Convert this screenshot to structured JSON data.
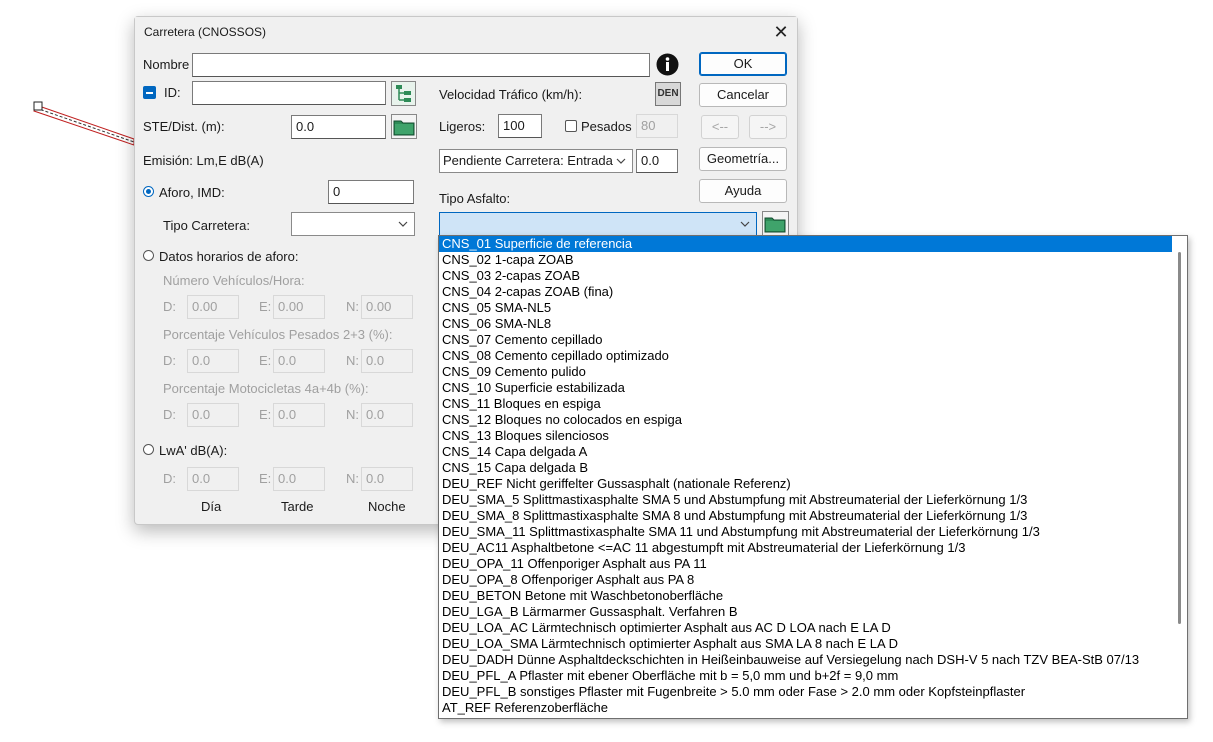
{
  "window": {
    "title": "Carretera (CNOSSOS)",
    "close_glyph": "✕"
  },
  "fields": {
    "nombre_label": "Nombre",
    "nombre_value": "",
    "id_label": "ID:",
    "id_value": "",
    "ste_label": "STE/Dist. (m):",
    "ste_value": "0.0",
    "emision_label": "Emisión: Lm,E dB(A)",
    "aforo_label": "Aforo, IMD:",
    "aforo_value": "0",
    "tipo_carretera_label": "Tipo Carretera:",
    "tipo_carretera_value": "",
    "datos_horarios_label": "Datos horarios de aforo:",
    "num_vehiculos_label": "Número Vehículos/Hora:",
    "pct_pesados_label": "Porcentaje Vehículos Pesados 2+3 (%):",
    "pct_moto_label": "Porcentaje Motocicletas  4a+4b (%):",
    "lwa_label": "LwA' dB(A):",
    "d_label": "D:",
    "e_label": "E:",
    "n_label": "N:",
    "row1": [
      "0.00",
      "0.00",
      "0.00"
    ],
    "row2": [
      "0.0",
      "0.0",
      "0.0"
    ],
    "row3": [
      "0.0",
      "0.0",
      "0.0"
    ],
    "row4": [
      "0.0",
      "0.0",
      "0.0"
    ],
    "dia_label": "Día",
    "tarde_label": "Tarde",
    "noche_label": "Noche"
  },
  "traffic": {
    "velocidad_label": "Velocidad Tráfico (km/h):",
    "den_label": "DEN",
    "ligeros_label": "Ligeros:",
    "ligeros_value": "100",
    "pesados_label": "Pesados",
    "pesados_value": "80",
    "pendiente_value": "Pendiente Carretera: Entrada",
    "pendiente_num": "0.0",
    "tipo_asfalto_label": "Tipo Asfalto:",
    "tipo_asfalto_value": ""
  },
  "buttons": {
    "ok": "OK",
    "cancelar": "Cancelar",
    "prev": "<--",
    "next": "-->",
    "geometria": "Geometría...",
    "ayuda": "Ayuda"
  },
  "asfalto_options": [
    "CNS_01 Superficie de referencia",
    "CNS_02 1-capa ZOAB",
    "CNS_03 2-capas ZOAB",
    "CNS_04 2-capas ZOAB (fina)",
    "CNS_05 SMA-NL5",
    "CNS_06 SMA-NL8",
    "CNS_07 Cemento cepillado",
    "CNS_08 Cemento cepillado optimizado",
    "CNS_09 Cemento pulido",
    "CNS_10 Superficie estabilizada",
    "CNS_11 Bloques en espiga",
    "CNS_12 Bloques no colocados en espiga",
    "CNS_13 Bloques silenciosos",
    "CNS_14 Capa delgada A",
    "CNS_15 Capa delgada B",
    "DEU_REF Nicht geriffelter Gussasphalt (nationale Referenz)",
    "DEU_SMA_5 Splittmastixasphalte SMA 5 und Abstumpfung mit Abstreumaterial der Lieferkörnung 1/3",
    "DEU_SMA_8 Splittmastixasphalte SMA 8 und Abstumpfung mit Abstreumaterial der Lieferkörnung 1/3",
    "DEU_SMA_11 Splittmastixasphalte SMA 11 und Abstumpfung mit Abstreumaterial der Lieferkörnung 1/3",
    "DEU_AC11 Asphaltbetone <=AC 11 abgestumpft mit Abstreumaterial der Lieferkörnung 1/3",
    "DEU_OPA_11 Offenporiger Asphalt aus PA 11",
    "DEU_OPA_8 Offenporiger Asphalt aus PA 8",
    "DEU_BETON Betone mit Waschbetonoberfläche",
    "DEU_LGA_B Lärmarmer Gussasphalt. Verfahren B",
    "DEU_LOA_AC Lärmtechnisch optimierter Asphalt aus AC D LOA nach E LA D",
    "DEU_LOA_SMA Lärmtechnisch optimierter Asphalt aus SMA LA 8 nach E LA D",
    "DEU_DADH Dünne Asphaltdeckschichten in Heißeinbauweise auf Versiegelung nach DSH-V 5 nach TZV BEA-StB 07/13",
    "DEU_PFL_A Pflaster mit ebener Oberfläche mit b = 5,0 mm und b+2f = 9,0 mm",
    "DEU_PFL_B sonstiges Pflaster mit Fugenbreite > 5.0 mm oder Fase > 2.0 mm oder Kopfsteinpflaster",
    "AT_REF Referenzoberfläche"
  ],
  "selected_option": "CNS_01 Superficie de referencia",
  "icons": {
    "info": "info-icon",
    "tree": "tree-icon",
    "folder": "folder-icon",
    "chevron": "chevron-down-icon"
  },
  "colors": {
    "accent": "#0067c0",
    "selection": "#0078d7",
    "folder_green": "#2e8b57"
  }
}
